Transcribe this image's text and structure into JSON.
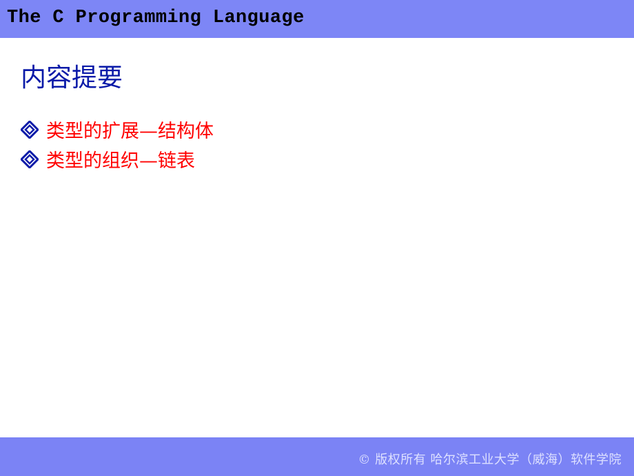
{
  "header": {
    "title": "The C Programming Language"
  },
  "slide": {
    "title": "内容提要",
    "bullets": [
      {
        "icon": "diamond-bullet-icon",
        "text": "类型的扩展—结构体"
      },
      {
        "icon": "diamond-bullet-icon",
        "text": "类型的组织—链表"
      }
    ]
  },
  "footer": {
    "copyright": "© 版权所有  哈尔滨工业大学（威海）软件学院"
  },
  "colors": {
    "band": "#7d86f6",
    "title": "#0a1aa8",
    "bullet_text": "#ff0000",
    "bullet_icon": "#0a1aa8"
  }
}
